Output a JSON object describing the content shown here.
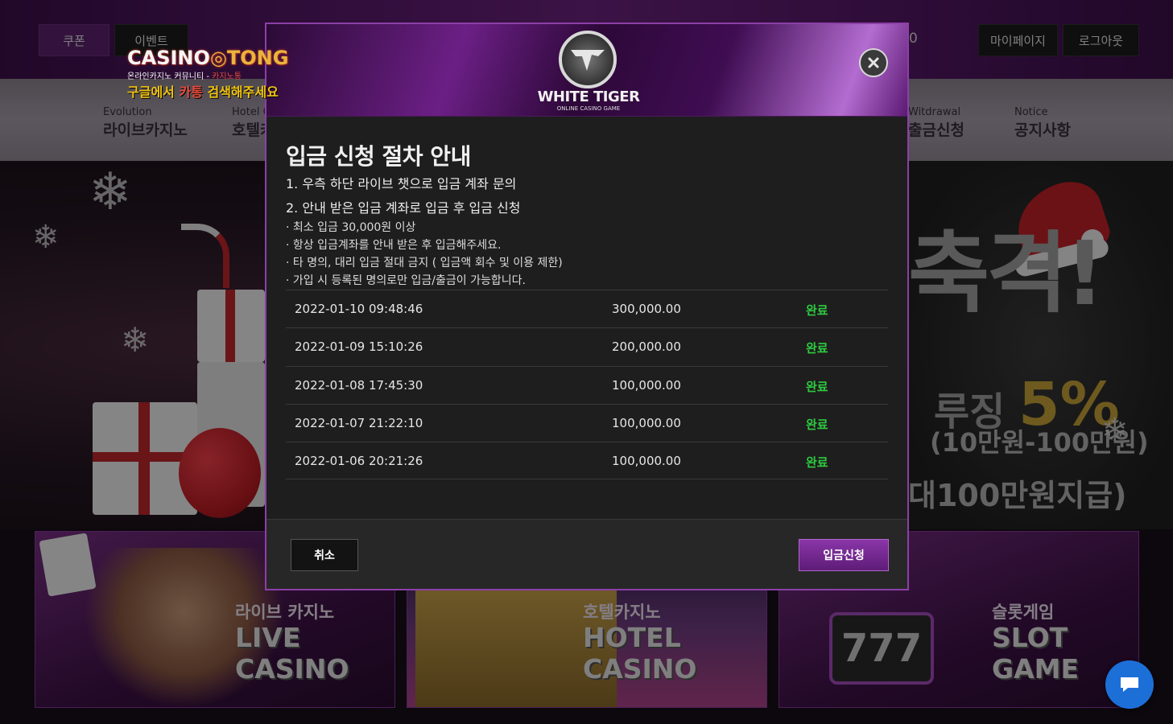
{
  "header": {
    "coupon_label": "쿠폰",
    "event_label": "이벤트",
    "mypage_label": "마이페이지",
    "logout_label": "로그아웃",
    "balance_fragment": "0"
  },
  "brand": {
    "line1_a": "CASINO",
    "line1_b": "TONG",
    "line2_a": "온라인카지노 커뮤니티 - ",
    "line2_b": "카지노통",
    "line3_a": "구글에서 ",
    "line3_b": "카통",
    "line3_c": " 검색해주세요"
  },
  "nav": [
    {
      "en": "Evolution",
      "ko": "라이브카지노"
    },
    {
      "en": "Hotel C",
      "ko": "호텔카"
    },
    {
      "en": "Witdrawal",
      "ko": "출금신청"
    },
    {
      "en": "Notice",
      "ko": "공지사항"
    }
  ],
  "hero": {
    "headline": "축격!",
    "rolling_label": "루징 ",
    "rolling_value": "5%",
    "range": "(10만원-100만원)",
    "max": "대100만원지급)"
  },
  "cards": [
    {
      "ko": "라이브 카지노",
      "en": "LIVE CASINO"
    },
    {
      "ko": "호텔카지노",
      "en": "HOTEL CASINO"
    },
    {
      "ko": "슬롯게임",
      "en": "SLOT GAME"
    }
  ],
  "modal": {
    "logo_title": "WHITE TIGER",
    "logo_sub": "ONLINE CASINO GAME",
    "title": "입금 신청 절차 안내",
    "steps": [
      "1. 우측 하단 라이브 챗으로 입금 계좌 문의",
      "2. 안내 받은 입금 계좌로 입금 후 입금 신청"
    ],
    "notes": [
      "· 최소 입금 30,000원 이상",
      "· 항상 입금계좌를 안내 받은 후 입금해주세요.",
      "· 타 명의, 대리 입금 절대 금지 ( 입금액 회수 및 이용 제한)",
      "· 가입 시 등록된 명의로만 입금/출금이 가능합니다."
    ],
    "history": [
      {
        "date": "2022-01-10 09:48:46",
        "amount": "300,000.00",
        "status": "완료"
      },
      {
        "date": "2022-01-09 15:10:26",
        "amount": "200,000.00",
        "status": "완료"
      },
      {
        "date": "2022-01-08 17:45:30",
        "amount": "100,000.00",
        "status": "완료"
      },
      {
        "date": "2022-01-07 21:22:10",
        "amount": "100,000.00",
        "status": "완료"
      },
      {
        "date": "2022-01-06 20:21:26",
        "amount": "100,000.00",
        "status": "완료"
      }
    ],
    "cancel_label": "취소",
    "submit_label": "입금신청"
  },
  "colors": {
    "accent": "#8c3fa8",
    "status_done": "#2ecc40",
    "chat": "#1d6fd8"
  },
  "icons": {
    "close": "close-icon",
    "chat": "chat-bubble-icon",
    "logo": "tiger-logo-icon"
  }
}
